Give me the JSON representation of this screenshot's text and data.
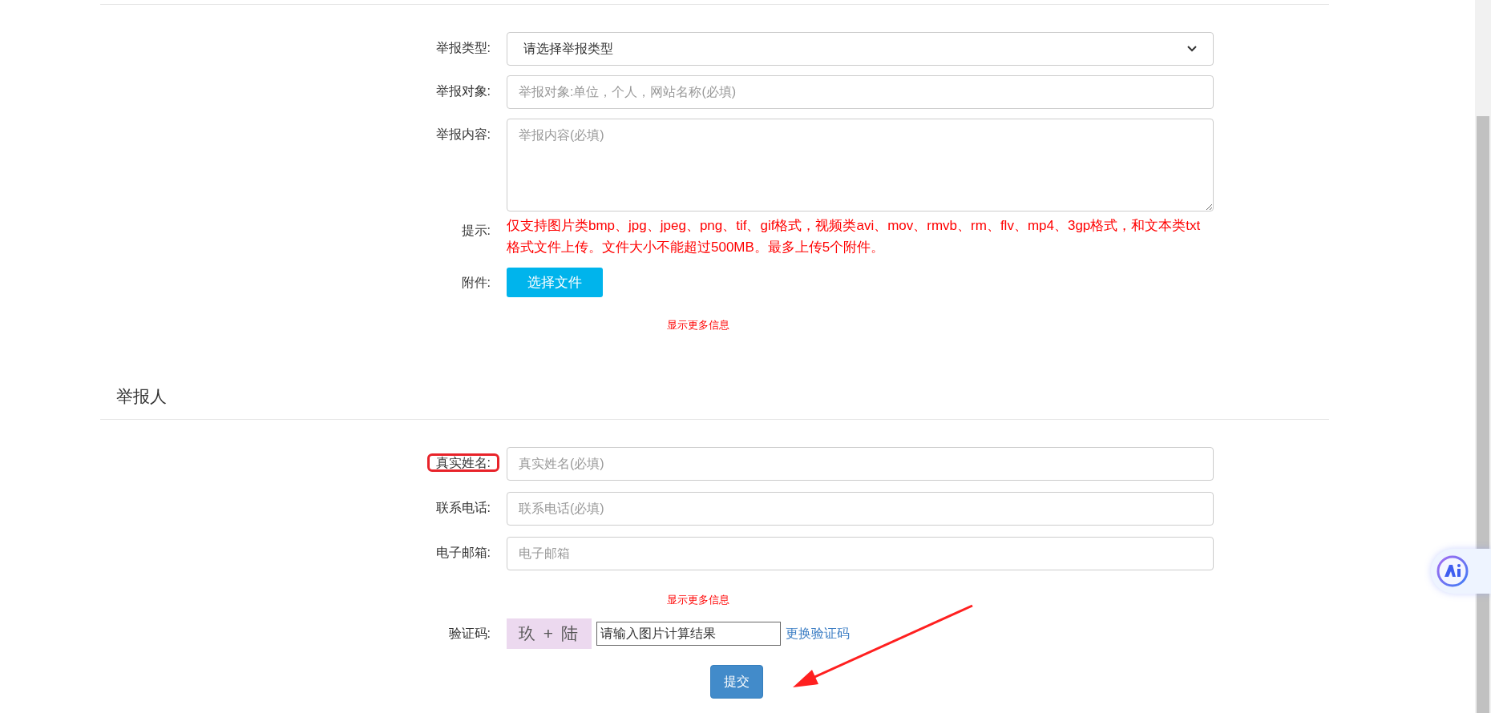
{
  "report_section": {
    "fields": [
      {
        "kind": "select",
        "label": "举报类型:",
        "value": "请选择举报类型"
      },
      {
        "kind": "input",
        "label": "举报对象:",
        "placeholder": "举报对象:单位，个人，网站名称(必填)"
      },
      {
        "kind": "textarea",
        "label": "举报内容:",
        "placeholder": "举报内容(必填)"
      },
      {
        "kind": "note",
        "label": "提示:",
        "text": "仅支持图片类bmp、jpg、jpeg、png、tif、gif格式，视频类avi、mov、rmvb、rm、flv、mp4、3gp格式，和文本类txt格式文件上传。文件大小不能超过500MB。最多上传5个附件。"
      },
      {
        "kind": "file",
        "label": "附件:",
        "button": "选择文件"
      }
    ],
    "more_link": "显示更多信息"
  },
  "reporter_section": {
    "title": "举报人",
    "fields": [
      {
        "kind": "input",
        "label": "真实姓名:",
        "placeholder": "真实姓名(必填)",
        "highlighted": true
      },
      {
        "kind": "input",
        "label": "联系电话:",
        "placeholder": "联系电话(必填)",
        "highlighted": false
      },
      {
        "kind": "input",
        "label": "电子邮箱:",
        "placeholder": "电子邮箱",
        "highlighted": false
      }
    ],
    "more_link": "显示更多信息",
    "captcha": {
      "label": "验证码:",
      "image_text": "玖 + 陆",
      "placeholder": "请输入图片计算结果",
      "refresh_link": "更换验证码"
    },
    "submit": "提交"
  }
}
